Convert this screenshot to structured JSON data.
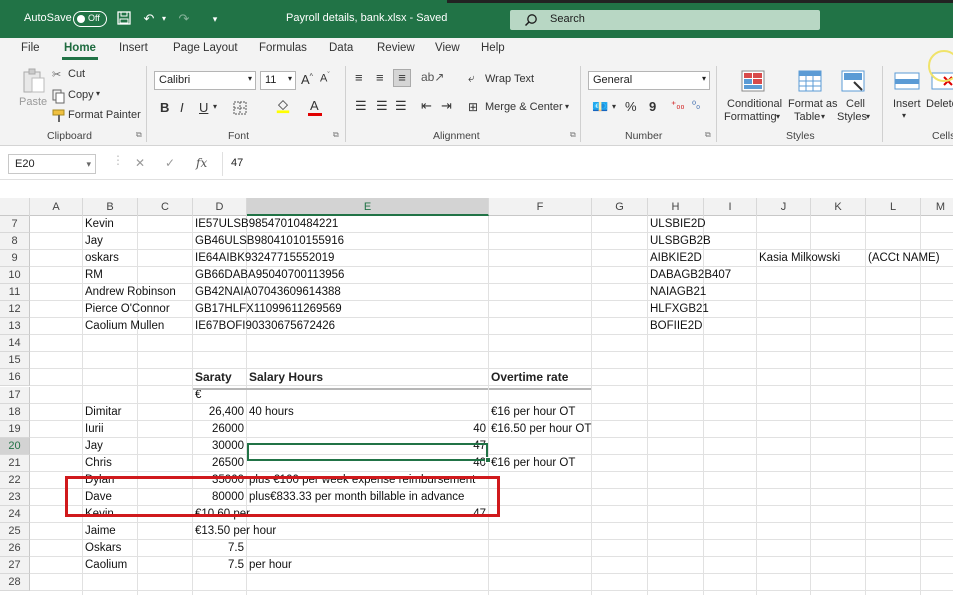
{
  "titlebar": {
    "autosave_label": "AutoSave",
    "autosave_state": "Off",
    "doc_title": "Payroll details, bank.xlsx  -  Saved",
    "search_placeholder": "Search"
  },
  "ribbon": {
    "tabs": [
      "File",
      "Home",
      "Insert",
      "Page Layout",
      "Formulas",
      "Data",
      "Review",
      "View",
      "Help"
    ],
    "clipboard": {
      "paste": "Paste",
      "cut": "Cut",
      "copy": "Copy",
      "format_painter": "Format Painter",
      "label": "Clipboard"
    },
    "font": {
      "name": "Calibri",
      "size": "11",
      "label": "Font"
    },
    "alignment": {
      "wrap_text": "Wrap Text",
      "merge_center": "Merge & Center",
      "label": "Alignment"
    },
    "number": {
      "format": "General",
      "label": "Number"
    },
    "styles": {
      "conditional": "Conditional",
      "conditional2": "Formatting",
      "format_as": "Format as",
      "format_as2": "Table",
      "cell": "Cell",
      "cell2": "Styles",
      "label": "Styles"
    },
    "cells": {
      "insert": "Insert",
      "delete": "Delete",
      "label": "Cells"
    }
  },
  "formula_bar": {
    "name_box": "E20",
    "formula": "47"
  },
  "columns": [
    "A",
    "B",
    "C",
    "D",
    "E",
    "F",
    "G",
    "H",
    "I",
    "J",
    "K",
    "L",
    "M"
  ],
  "rows": [
    "7",
    "8",
    "9",
    "10",
    "11",
    "12",
    "13",
    "14",
    "15",
    "16",
    "17",
    "18",
    "19",
    "20",
    "21",
    "22",
    "23",
    "24",
    "25",
    "26",
    "27",
    "28"
  ],
  "cells": {
    "B7": "Kevin",
    "D7": "IE57ULSB98547010484221",
    "H7": "ULSBIE2D",
    "B8": "Jay",
    "D8": "GB46ULSB98041010155916",
    "H8": "ULSBGB2B",
    "B9": "oskars",
    "D9": "IE64AIBK93247715552019",
    "H9": "AIBKIE2D",
    "J9": "Kasia Milkowski",
    "L9": "(ACCt NAME)",
    "B10": "RM",
    "D10": "GB66DABA95040700113956",
    "H10": "DABAGB2B407",
    "B11": "Andrew Robinson",
    "D11": "GB42NAIA07043609614388",
    "H11": "NAIAGB21",
    "B12": "Pierce O'Connor",
    "D12": "GB17HLFX11099611269569",
    "H12": "HLFXGB21",
    "B13": "Caolium Mullen",
    "D13": "IE67BOFI90330675672426",
    "H13": "BOFIIE2D",
    "D16": "Saraty",
    "E16": "Salary Hours",
    "F16": "Overtime rate",
    "D17": "€",
    "B18": "Dimitar",
    "D18": "26,400",
    "E18": "40 hours",
    "F18": "€16 per hour OT",
    "B19": "Iurii",
    "D19": "26000",
    "E19": "40",
    "F19": "€16.50 per hour OT",
    "B20": "Jay",
    "D20": "30000",
    "E20": "47",
    "B21": "Chris",
    "D21": "26500",
    "E21": "40",
    "F21": "€16 per hour OT",
    "B22": "Dylan",
    "D22": "35000",
    "E22": "plus €100 per week expense reimbursement",
    "B23": "Dave",
    "D23": "80000",
    "E23": "plus€833.33 per month billable in advance",
    "B24": "Kevin",
    "D24": "€10.60 per",
    "E24": "47",
    "B25": "Jaime",
    "D25": "€13.50 per hour",
    "B26": "Oskars",
    "D26": "7.5",
    "B27": "Caolium",
    "D27": "7.5",
    "E27": "per hour"
  }
}
